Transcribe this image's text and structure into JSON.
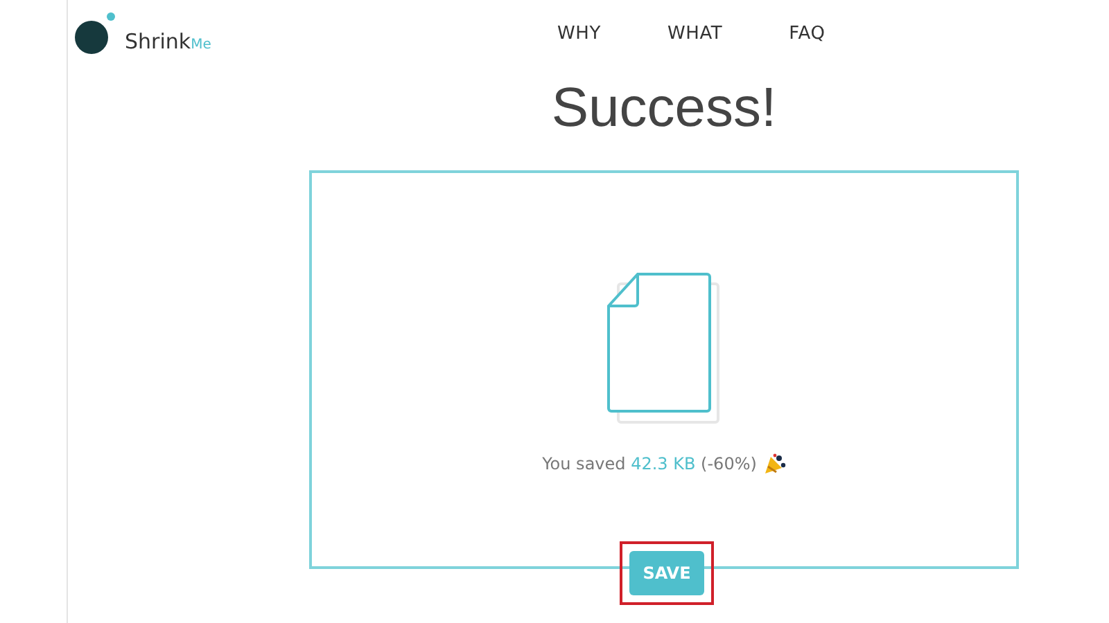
{
  "logo": {
    "name": "Shrink",
    "suffix": "Me"
  },
  "nav": [
    {
      "label": "WHY"
    },
    {
      "label": "WHAT"
    },
    {
      "label": "FAQ"
    }
  ],
  "title": "Success!",
  "result": {
    "prefix": "You saved",
    "amount": "42.3 KB",
    "suffix": "(-60%)"
  },
  "save_button": {
    "label": "SAVE",
    "highlighted": true
  }
}
